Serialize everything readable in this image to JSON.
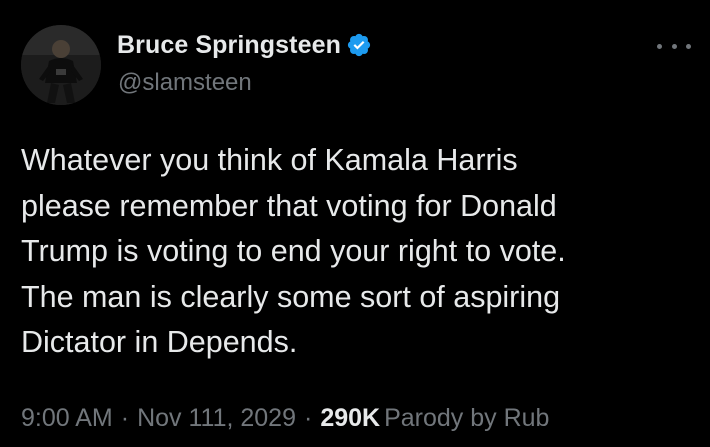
{
  "tweet": {
    "author": {
      "display_name": "Bruce Springsteen",
      "handle": "@slamsteen",
      "verified_icon": "verified-badge-icon",
      "avatar_icon": "profile-photo"
    },
    "more_icon": "more-options-icon",
    "text_lines": [
      "Whatever you think of Kamala Harris",
      "please remember that voting for Donald",
      "Trump is voting to end your right to vote.",
      "The man is clearly some sort of aspiring",
      "Dictator in Depends."
    ],
    "meta": {
      "time": "9:00 AM",
      "separator": "·",
      "date": "Nov 111, 2029",
      "views_count": "290K",
      "views_label": "Parody by Rub"
    }
  },
  "colors": {
    "background": "#000000",
    "primary_text": "#e7e9ea",
    "secondary_text": "#71767b",
    "verified_blue": "#1d9bf0"
  }
}
